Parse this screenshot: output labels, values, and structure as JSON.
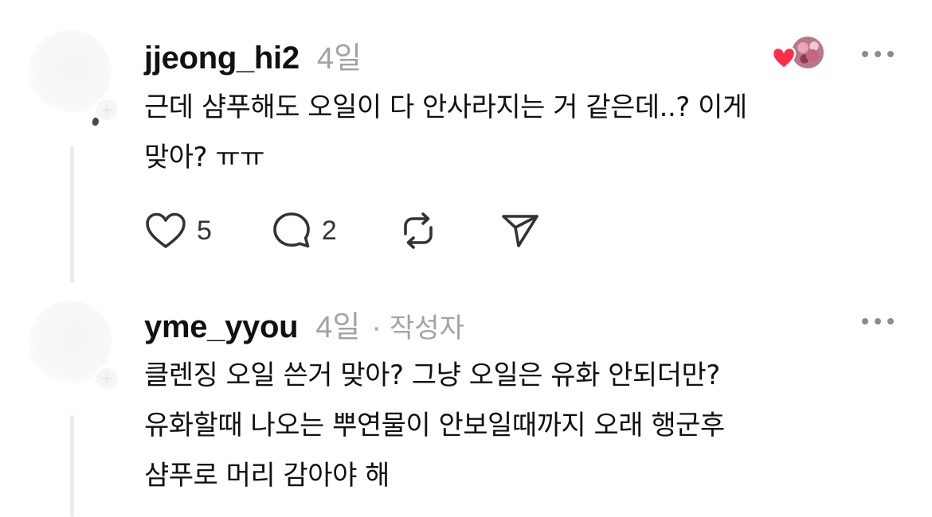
{
  "comments": [
    {
      "username": "jjeong_hi2",
      "time": "4일",
      "text_lines": [
        "근데 샴푸해도 오일이 다 안사라지는 거 같은데..? 이게",
        "맞아? ㅠㅠ"
      ],
      "likes": "5",
      "replies": "2",
      "liked_by_author": true
    },
    {
      "username": "yme_yyou",
      "time": "4일",
      "separator": "·",
      "badge": "작성자",
      "text_lines": [
        "클렌징 오일 쓴거 맞아? 그냥 오일은 유화 안되더만?",
        "유화할때 나오는 뿌연물이 안보일때까지 오래 행군후",
        "샴푸로 머리 감아야 해"
      ]
    }
  ],
  "icons": {
    "like": "heart-outline-icon",
    "reply": "speech-bubble-icon",
    "repost": "repost-icon",
    "share": "send-icon",
    "more": "more-dots-icon",
    "liked_heart": "heart-filled-icon"
  },
  "colors": {
    "text": "#111111",
    "meta": "#a3a3a3",
    "icon": "#333333",
    "heart": "#ff2d4a",
    "thread_line": "#ebebeb"
  }
}
